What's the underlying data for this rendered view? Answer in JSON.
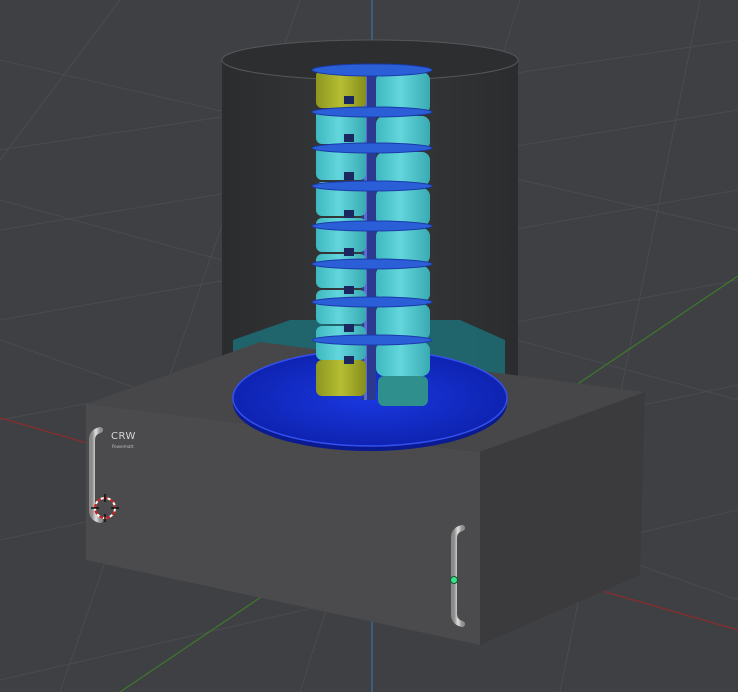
{
  "app": {
    "window_title": ""
  },
  "device": {
    "brand_label": "CRW",
    "sub_label": "Powermatt"
  },
  "colors": {
    "viewport_bg": "#3f4043",
    "grid_line": "#4a4b4f",
    "axis_x": "#8a2c2c",
    "axis_y": "#3c7a2c",
    "axis_z": "#3a6ea8",
    "housing": "#2a2c2e",
    "base_front": "#4b4b4d",
    "base_top": "#474749",
    "base_side": "#3b3b3d",
    "platter": "#1029c8",
    "cell": "#4fc9cf",
    "cell_highlight": "#a4ad28",
    "ring": "#2b5fd8",
    "handle": "#b5b5b5"
  },
  "icons": {
    "origin": "3d-cursor-icon",
    "pivot": "pivot-point-icon"
  }
}
